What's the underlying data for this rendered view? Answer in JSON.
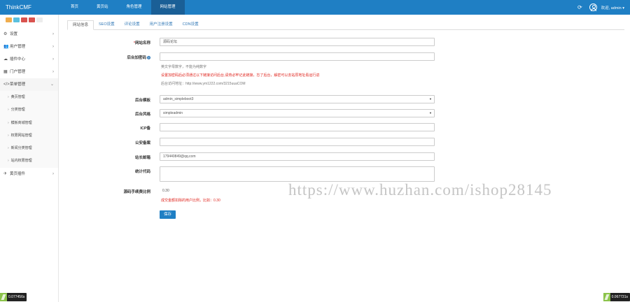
{
  "header": {
    "brand": "ThinkCMF",
    "nav": [
      {
        "label": "首页",
        "active": false
      },
      {
        "label": "黄页站",
        "active": false
      },
      {
        "label": "角色管理",
        "active": false
      },
      {
        "label": "网站管理",
        "active": true
      }
    ],
    "user": "欢迎, admin ▾"
  },
  "sidebar": {
    "items": [
      {
        "label": "设置",
        "icon": "gear-icon"
      },
      {
        "label": "用户管理",
        "icon": "users-icon"
      },
      {
        "label": "插件中心",
        "icon": "cloud-icon"
      },
      {
        "label": "门户管理",
        "icon": "th-icon"
      },
      {
        "label": "菜单管理",
        "icon": "code-icon",
        "open": true
      }
    ],
    "sub_items": [
      "黄页管理",
      "分类管理",
      "模板商城管理",
      "权限网站管理",
      "新闻分类管理",
      "站内权限管理"
    ],
    "last_item": {
      "label": "黄页插件",
      "icon": "plane-icon"
    }
  },
  "tabs": [
    "网站信息",
    "SEO设置",
    "评论设置",
    "用户注册设置",
    "CDN设置"
  ],
  "form": {
    "site_name_label": "网站名称",
    "site_name_value": "源码论坛",
    "admin_addr_label": "后台加密码",
    "admin_addr_help1": "英文字母数字，不能为纯数字",
    "admin_addr_help2": "设置加密码后必须通过以下链接访问后台,请劳必牢记此链接，忘了后台，解密可以去站原地址看运行进",
    "admin_addr_help3": "后台访问地址：http://www.ym1222.com/3215uuaCOM",
    "admin_theme_label": "后台模板",
    "admin_theme_value": "admin_simpleboot3",
    "admin_style_label": "后台风格",
    "admin_style_value": "simpleadmin",
    "icp_label": "ICP备",
    "police_label": "公安备案",
    "email_label": "站长邮箱",
    "email_value": "179440849@qq.com",
    "stats_label": "统计代码",
    "ratio_label": "源码手续费比例",
    "ratio_value": "0.30",
    "ratio_help": "成交金额扣除的用户比例，比如：0.30",
    "save_label": "保存"
  },
  "watermark": "https://www.huzhan.com/ishop28145",
  "debug": {
    "left": "0.077456s",
    "right": "0.067731s"
  }
}
